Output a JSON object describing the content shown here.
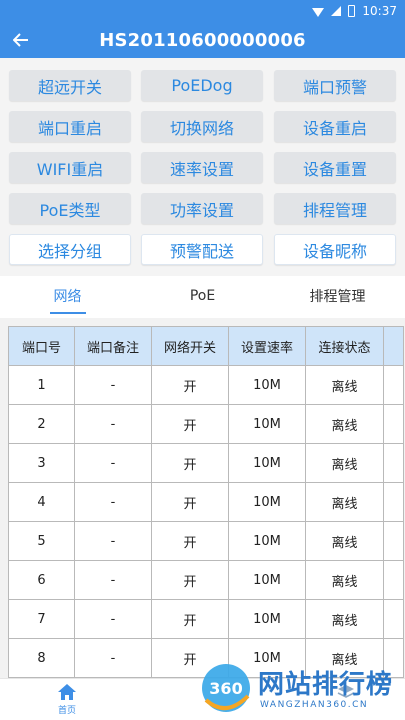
{
  "status_bar": {
    "time": "10:37"
  },
  "app_bar": {
    "title": "HS20110600000006"
  },
  "actions": [
    {
      "label": "超远开关"
    },
    {
      "label": "PoEDog"
    },
    {
      "label": "端口预警"
    },
    {
      "label": "端口重启"
    },
    {
      "label": "切换网络"
    },
    {
      "label": "设备重启"
    },
    {
      "label": "WIFI重启"
    },
    {
      "label": "速率设置"
    },
    {
      "label": "设备重置"
    },
    {
      "label": "PoE类型"
    },
    {
      "label": "功率设置"
    },
    {
      "label": "排程管理"
    },
    {
      "label": "选择分组"
    },
    {
      "label": "预警配送"
    },
    {
      "label": "设备昵称"
    }
  ],
  "tabs": [
    {
      "label": "网络",
      "active": true
    },
    {
      "label": "PoE",
      "active": false
    },
    {
      "label": "排程管理",
      "active": false
    }
  ],
  "table": {
    "headers": [
      "端口号",
      "端口备注",
      "网络开关",
      "设置速率",
      "连接状态"
    ],
    "rows": [
      [
        "1",
        "-",
        "开",
        "10M",
        "离线"
      ],
      [
        "2",
        "-",
        "开",
        "10M",
        "离线"
      ],
      [
        "3",
        "-",
        "开",
        "10M",
        "离线"
      ],
      [
        "4",
        "-",
        "开",
        "10M",
        "离线"
      ],
      [
        "5",
        "-",
        "开",
        "10M",
        "离线"
      ],
      [
        "6",
        "-",
        "开",
        "10M",
        "离线"
      ],
      [
        "7",
        "-",
        "开",
        "10M",
        "离线"
      ],
      [
        "8",
        "-",
        "开",
        "10M",
        "离线"
      ]
    ]
  },
  "bottom_nav": {
    "home_label": "首页"
  },
  "watermark": {
    "logo_text": "360",
    "brand": "网站排行榜",
    "url": "WANGZHAN360.CN"
  },
  "colors": {
    "primary": "#3d8ee6",
    "button_bg": "#e2e4e7",
    "header_bg": "#cfe4f9"
  }
}
